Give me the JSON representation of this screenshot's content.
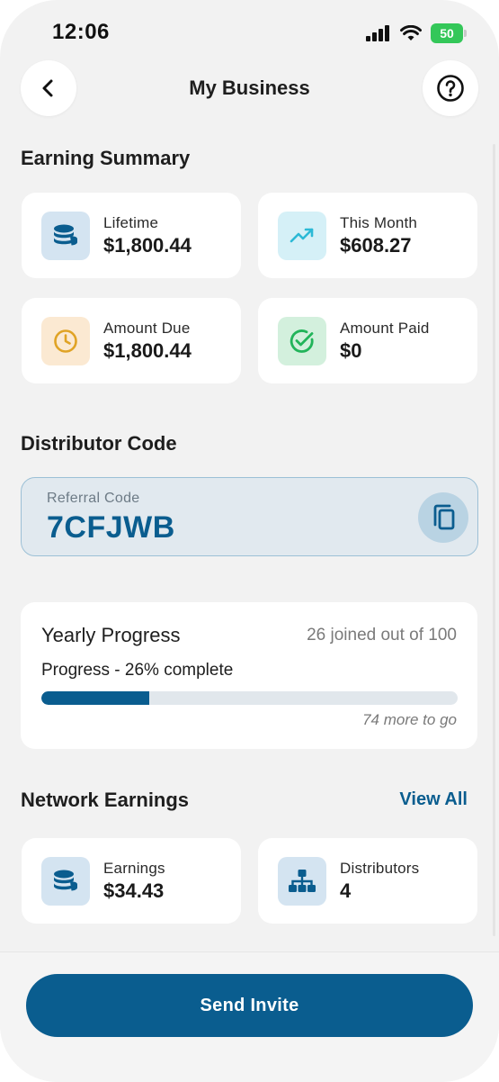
{
  "status_bar": {
    "time": "12:06",
    "battery": "50"
  },
  "header": {
    "title": "My Business"
  },
  "earning_summary": {
    "title": "Earning Summary",
    "cards": [
      {
        "label": "Lifetime",
        "value": "$1,800.44",
        "icon": "coins-icon",
        "color": "#0a5d8f"
      },
      {
        "label": "This Month",
        "value": "$608.27",
        "icon": "trending-up-icon",
        "color": "#2cb9d6"
      },
      {
        "label": "Amount Due",
        "value": "$1,800.44",
        "icon": "clock-icon",
        "color": "#e0a325"
      },
      {
        "label": "Amount Paid",
        "value": "$0",
        "icon": "check-circle-icon",
        "color": "#22b45a"
      }
    ]
  },
  "distributor_code": {
    "title": "Distributor Code",
    "label": "Referral Code",
    "code": "7CFJWB"
  },
  "yearly_progress": {
    "title": "Yearly Progress",
    "joined_text": "26 joined out of 100",
    "progress_text": "Progress - 26% complete",
    "progress_fraction": 0.26,
    "remaining_text": "74 more to go"
  },
  "network_earnings": {
    "title": "Network Earnings",
    "view_all": "View All",
    "cards": [
      {
        "label": "Earnings",
        "value": "$34.43",
        "icon": "coins-icon"
      },
      {
        "label": "Distributors",
        "value": "4",
        "icon": "hierarchy-icon"
      }
    ]
  },
  "actions": {
    "send_invite": "Send Invite"
  },
  "colors": {
    "primary": "#0a5d8f",
    "background": "#f2f2f2",
    "card": "#ffffff"
  }
}
